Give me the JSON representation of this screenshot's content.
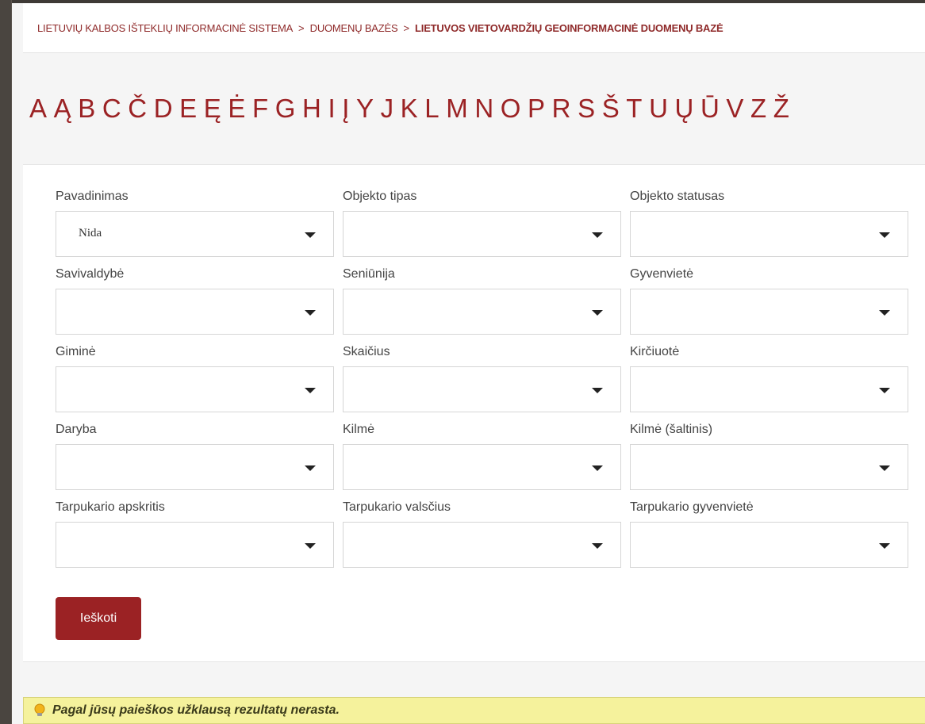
{
  "breadcrumb": {
    "items": [
      "LIETUVIŲ KALBOS IŠTEKLIŲ INFORMACINĖ SISTEMA",
      "DUOMENŲ BAZĖS",
      "LIETUVOS VIETOVARDŽIŲ GEOINFORMACINĖ DUOMENŲ BAZĖ"
    ],
    "separator": ">"
  },
  "alphabet": [
    "A",
    "Ą",
    "B",
    "C",
    "Č",
    "D",
    "E",
    "Ę",
    "Ė",
    "F",
    "G",
    "H",
    "I",
    "Į",
    "Y",
    "J",
    "K",
    "L",
    "M",
    "N",
    "O",
    "P",
    "R",
    "S",
    "Š",
    "T",
    "U",
    "Ų",
    "Ū",
    "V",
    "Z",
    "Ž"
  ],
  "form": {
    "fields": [
      {
        "label": "Pavadinimas",
        "value": "Nida"
      },
      {
        "label": "Objekto tipas",
        "value": ""
      },
      {
        "label": "Objekto statusas",
        "value": ""
      },
      {
        "label": "Savivaldybė",
        "value": ""
      },
      {
        "label": "Seniūnija",
        "value": ""
      },
      {
        "label": "Gyvenvietė",
        "value": ""
      },
      {
        "label": "Giminė",
        "value": ""
      },
      {
        "label": "Skaičius",
        "value": ""
      },
      {
        "label": "Kirčiuotė",
        "value": ""
      },
      {
        "label": "Daryba",
        "value": ""
      },
      {
        "label": "Kilmė",
        "value": ""
      },
      {
        "label": "Kilmė (šaltinis)",
        "value": ""
      },
      {
        "label": "Tarpukario apskritis",
        "value": ""
      },
      {
        "label": "Tarpukario valsčius",
        "value": ""
      },
      {
        "label": "Tarpukario gyvenvietė",
        "value": ""
      }
    ],
    "search_label": "Ieškoti"
  },
  "notice": {
    "icon": "lightbulb-icon",
    "text": "Pagal jūsų paieškos užklausą rezultatų nerasta."
  },
  "colors": {
    "accent": "#9b2224",
    "notice_bg": "#f5f29c"
  }
}
